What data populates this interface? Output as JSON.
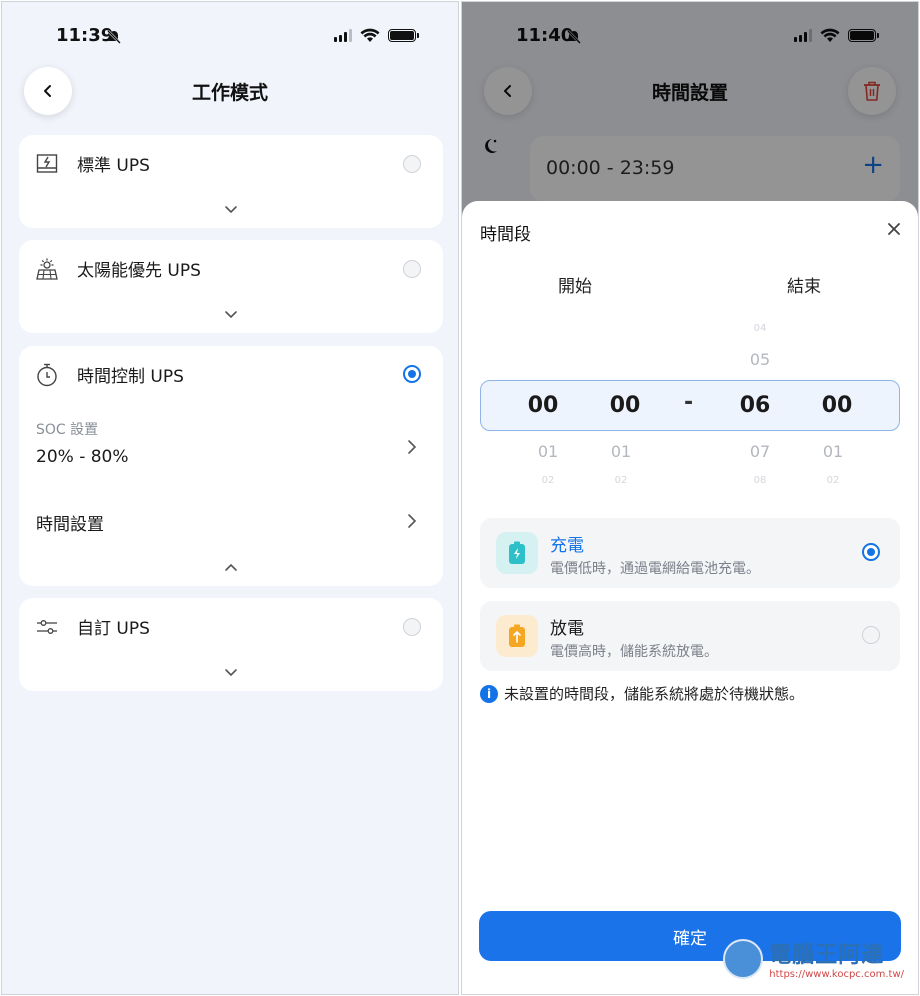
{
  "left": {
    "status_time": "11:39",
    "title": "工作模式",
    "cards": [
      {
        "title": "標準 UPS",
        "selected": false,
        "icon": "inverter-icon"
      },
      {
        "title": "太陽能優先 UPS",
        "selected": false,
        "icon": "solar-panel-icon"
      },
      {
        "title": "時間控制 UPS",
        "selected": true,
        "icon": "timer-icon",
        "soc_label": "SOC 設置",
        "soc_value": "20% - 80%",
        "time_setting_label": "時間設置"
      },
      {
        "title": "自訂 UPS",
        "selected": false,
        "icon": "sliders-icon"
      }
    ]
  },
  "right": {
    "status_time": "11:40",
    "title": "時間設置",
    "range_text": "00:00 - 23:59",
    "sheet": {
      "title": "時間段",
      "start_label": "開始",
      "end_label": "結束",
      "picker": {
        "start_hour": {
          "selected": "00",
          "next": "01",
          "next2": "02"
        },
        "start_min": {
          "selected": "00",
          "next": "01",
          "next2": "02"
        },
        "end_hour": {
          "prev2": "04",
          "prev": "05",
          "selected": "06",
          "next": "07",
          "next2": "08"
        },
        "end_min": {
          "selected": "00",
          "next": "01",
          "next2": "02"
        },
        "separator": "-"
      },
      "modes": [
        {
          "title": "充電",
          "desc": "電價低時，通過電網給電池充電。",
          "selected": true,
          "icon": "battery-charge-icon",
          "color": "#1473e6"
        },
        {
          "title": "放電",
          "desc": "電價高時，儲能系統放電。",
          "selected": false,
          "icon": "battery-discharge-icon",
          "color": "#1a1a1a"
        }
      ],
      "info": "未設置的時間段，儲能系統將處於待機狀態。",
      "info_icon": "i",
      "confirm_label": "確定"
    }
  },
  "watermark": {
    "brand": "電腦王阿達",
    "url": "https://www.kocpc.com.tw/"
  },
  "colors": {
    "accent": "#1473e6",
    "background": "#f1f4fb",
    "danger": "#e0483d"
  }
}
